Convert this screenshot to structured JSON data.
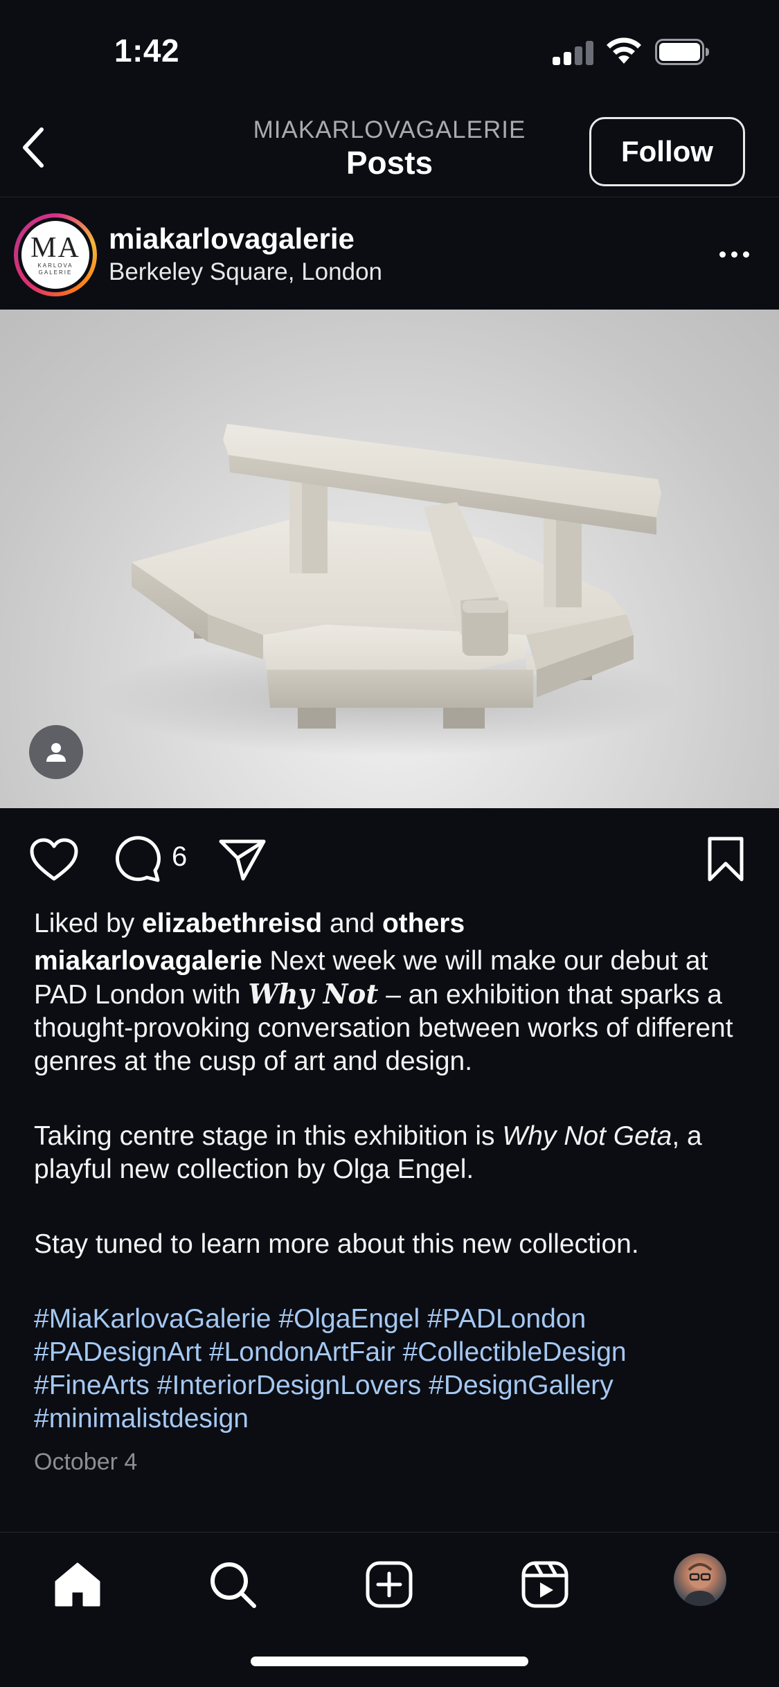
{
  "status_bar": {
    "time": "1:42"
  },
  "header": {
    "kicker": "MIAKARLOVAGALERIE",
    "title": "Posts",
    "follow_label": "Follow"
  },
  "post": {
    "avatar_logo": {
      "mark": "MA",
      "sub1": "KARLOVA",
      "sub2": "GALERIE"
    },
    "username": "miakarlovagalerie",
    "location": "Berkeley Square, London",
    "comment_count": "6",
    "likes": {
      "prefix": "Liked by",
      "user": "elizabethreisd",
      "joiner": "and",
      "others": "others"
    },
    "caption": {
      "username": "miakarlovagalerie",
      "p1_a": "Next week we will make our debut at PAD London with",
      "p1_em": "Why Not",
      "p1_b": "– an exhibition that sparks a thought-provoking conversation between works of different genres at the cusp of art and design.",
      "p2_a": "Taking centre stage in this exhibition is",
      "p2_em": "Why Not Geta",
      "p2_b": ", a playful new collection by Olga Engel.",
      "p3": "Stay tuned to learn more about this new collection.",
      "hashtags": [
        "#MiaKarlovaGalerie",
        "#OlgaEngel",
        "#PADLondon",
        "#PADesignArt",
        "#LondonArtFair",
        "#CollectibleDesign",
        "#FineArts",
        "#InteriorDesignLovers",
        "#DesignGallery",
        "#minimalistdesign"
      ]
    },
    "date": "October 4"
  },
  "colors": {
    "background": "#0b0d13",
    "hashtag": "#a5c8f2",
    "muted": "#8b8e94"
  },
  "icons": {
    "nav": [
      "chevron-left-icon",
      "more-horizontal-icon"
    ],
    "actions": [
      "heart-icon",
      "comment-icon",
      "send-icon",
      "bookmark-icon"
    ],
    "tabs": [
      "home-icon",
      "search-icon",
      "add-post-icon",
      "reels-icon",
      "profile-avatar"
    ]
  }
}
